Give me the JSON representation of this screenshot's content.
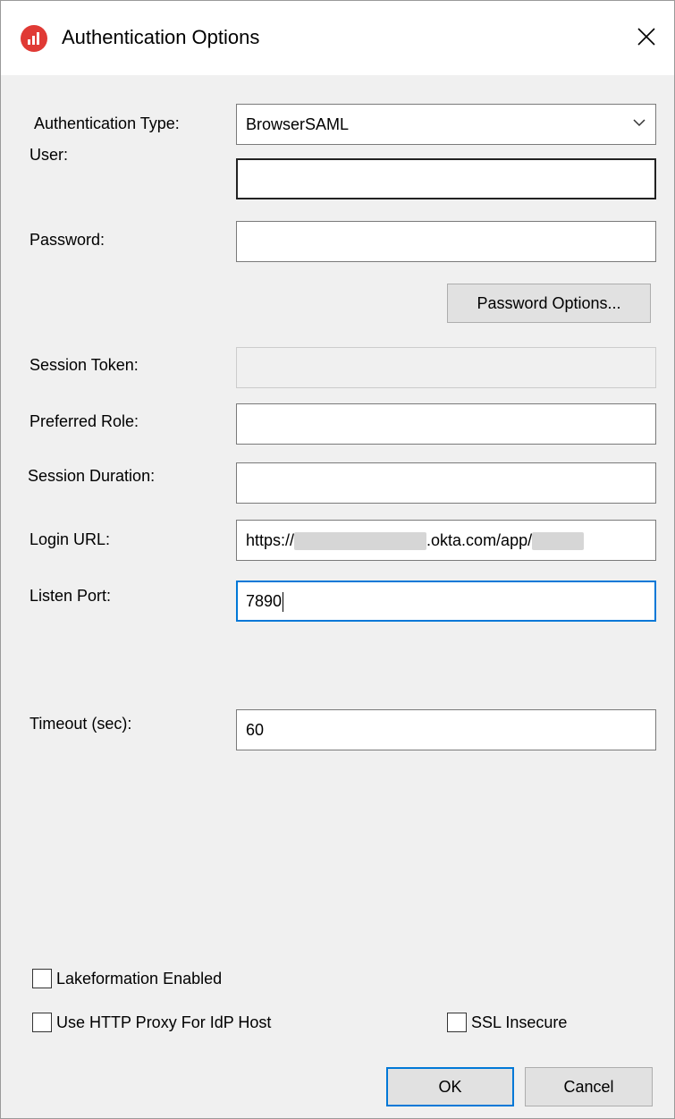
{
  "window": {
    "title": "Authentication Options",
    "app_icon": "app-logo-icon",
    "close_icon": "close-icon"
  },
  "form": {
    "auth_type": {
      "label": "Authentication Type:",
      "value": "BrowserSAML"
    },
    "user": {
      "label": "User:",
      "value": ""
    },
    "password": {
      "label": "Password:",
      "value": ""
    },
    "password_options_button": "Password Options...",
    "session_token": {
      "label": "Session Token:",
      "value": ""
    },
    "preferred_role": {
      "label": "Preferred Role:",
      "value": ""
    },
    "session_duration": {
      "label": "Session Duration:",
      "value": ""
    },
    "login_url": {
      "label": "Login URL:",
      "prefix": "https://",
      "middle": ".okta.com/app/"
    },
    "listen_port": {
      "label": "Listen Port:",
      "value": "7890"
    },
    "timeout": {
      "label": "Timeout (sec):",
      "value": "60"
    }
  },
  "checkboxes": {
    "lakeformation": {
      "label": "Lakeformation Enabled",
      "checked": false
    },
    "http_proxy": {
      "label": "Use HTTP Proxy For IdP Host",
      "checked": false
    },
    "ssl_insecure": {
      "label": "SSL Insecure",
      "checked": false
    }
  },
  "buttons": {
    "ok": "OK",
    "cancel": "Cancel"
  },
  "colors": {
    "accent": "#0078d7",
    "app_icon": "#e03a35"
  }
}
